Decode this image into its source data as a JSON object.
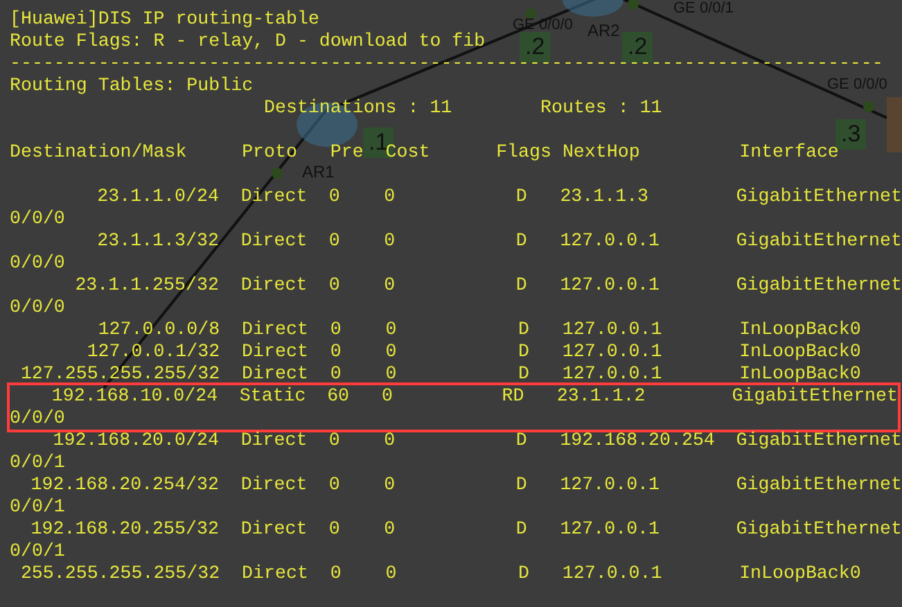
{
  "terminal": {
    "lines": [
      "[Huawei]DIS IP routing-table",
      "Route Flags: R - relay, D - download to fib",
      "-------------------------------------------------------------------------------",
      "Routing Tables: Public"
    ],
    "summary": {
      "destinations": "Destinations : 11",
      "routes": "Routes : 11"
    },
    "header": {
      "destination": "Destination/Mask",
      "proto": "Proto",
      "pre": "Pre",
      "cost": "Cost",
      "flags": "Flags",
      "nexthop": "NextHop",
      "interface": "Interface"
    },
    "rows": [
      {
        "destination": "23.1.1.0/24",
        "proto": "Direct",
        "pre": "0",
        "cost": "0",
        "flags": "D",
        "nexthop": "23.1.1.3",
        "interface": "GigabitEthernet",
        "interface_cont": "0/0/0",
        "highlighted": false
      },
      {
        "destination": "23.1.1.3/32",
        "proto": "Direct",
        "pre": "0",
        "cost": "0",
        "flags": "D",
        "nexthop": "127.0.0.1",
        "interface": "GigabitEthernet",
        "interface_cont": "0/0/0",
        "highlighted": false
      },
      {
        "destination": "23.1.1.255/32",
        "proto": "Direct",
        "pre": "0",
        "cost": "0",
        "flags": "D",
        "nexthop": "127.0.0.1",
        "interface": "GigabitEthernet",
        "interface_cont": "0/0/0",
        "highlighted": false
      },
      {
        "destination": "127.0.0.0/8",
        "proto": "Direct",
        "pre": "0",
        "cost": "0",
        "flags": "D",
        "nexthop": "127.0.0.1",
        "interface": "InLoopBack0",
        "highlighted": false
      },
      {
        "destination": "127.0.0.1/32",
        "proto": "Direct",
        "pre": "0",
        "cost": "0",
        "flags": "D",
        "nexthop": "127.0.0.1",
        "interface": "InLoopBack0",
        "highlighted": false
      },
      {
        "destination": "127.255.255.255/32",
        "proto": "Direct",
        "pre": "0",
        "cost": "0",
        "flags": "D",
        "nexthop": "127.0.0.1",
        "interface": "InLoopBack0",
        "highlighted": false
      },
      {
        "destination": "192.168.10.0/24",
        "proto": "Static",
        "pre": "60",
        "cost": "0",
        "flags": "RD",
        "nexthop": "23.1.1.2",
        "interface": "GigabitEthernet",
        "interface_cont": "0/0/0",
        "highlighted": true
      },
      {
        "destination": "192.168.20.0/24",
        "proto": "Direct",
        "pre": "0",
        "cost": "0",
        "flags": "D",
        "nexthop": "192.168.20.254",
        "interface": "GigabitEthernet",
        "interface_cont": "0/0/1",
        "highlighted": false
      },
      {
        "destination": "192.168.20.254/32",
        "proto": "Direct",
        "pre": "0",
        "cost": "0",
        "flags": "D",
        "nexthop": "127.0.0.1",
        "interface": "GigabitEthernet",
        "interface_cont": "0/0/1",
        "highlighted": false
      },
      {
        "destination": "192.168.20.255/32",
        "proto": "Direct",
        "pre": "0",
        "cost": "0",
        "flags": "D",
        "nexthop": "127.0.0.1",
        "interface": "GigabitEthernet",
        "interface_cont": "0/0/1",
        "highlighted": false
      },
      {
        "destination": "255.255.255.255/32",
        "proto": "Direct",
        "pre": "0",
        "cost": "0",
        "flags": "D",
        "nexthop": "127.0.0.1",
        "interface": "InLoopBack0",
        "highlighted": false
      }
    ]
  },
  "topology": {
    "labels": [
      {
        "kind": "port",
        "text": "GE 0/0/0"
      },
      {
        "kind": "device",
        "text": "AR2"
      },
      {
        "kind": "port",
        "text": "GE 0/0/1"
      },
      {
        "kind": "address",
        "text": ".2"
      },
      {
        "kind": "address",
        "text": ".2"
      },
      {
        "kind": "port",
        "text": "GE 0/0/0"
      },
      {
        "kind": "address",
        "text": ".3"
      },
      {
        "kind": "address",
        "text": ".1"
      },
      {
        "kind": "device",
        "text": "AR1"
      }
    ]
  }
}
